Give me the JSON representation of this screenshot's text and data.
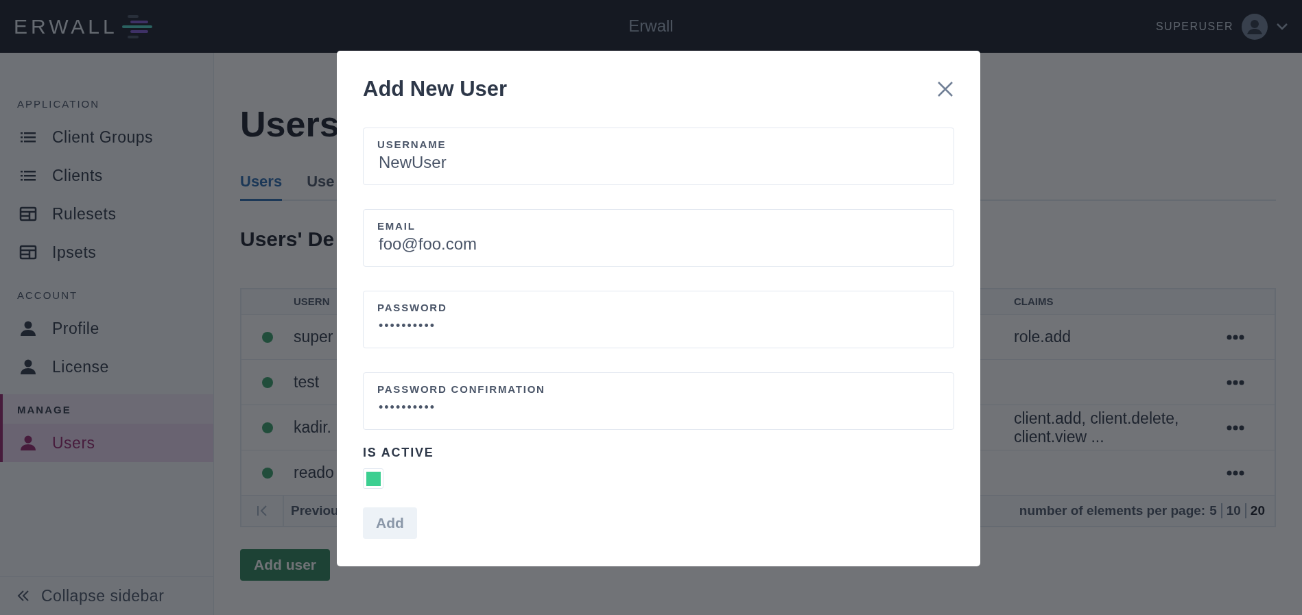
{
  "header": {
    "logo": "ERWALL",
    "title": "Erwall",
    "user": "SUPERUSER"
  },
  "sidebar": {
    "sections": [
      {
        "title": "APPLICATION",
        "items": [
          {
            "label": "Client Groups",
            "selected": false
          },
          {
            "label": "Clients",
            "selected": false
          },
          {
            "label": "Rulesets",
            "selected": false
          },
          {
            "label": "Ipsets",
            "selected": false
          }
        ]
      },
      {
        "title": "ACCOUNT",
        "items": [
          {
            "label": "Profile",
            "selected": false
          },
          {
            "label": "License",
            "selected": false
          }
        ]
      },
      {
        "title": "MANAGE",
        "items": [
          {
            "label": "Users",
            "selected": true
          }
        ]
      }
    ],
    "collapse": "Collapse sidebar"
  },
  "page": {
    "title": "Users",
    "tabs": [
      {
        "label": "Users",
        "selected": true
      },
      {
        "label": "Use",
        "selected": false
      }
    ],
    "section_title": "Users' De"
  },
  "table": {
    "columns": [
      "USERN",
      "CLAIMS"
    ],
    "rows": [
      {
        "active": true,
        "username": "super",
        "claims": "role.add"
      },
      {
        "active": true,
        "username": "test",
        "claims": ""
      },
      {
        "active": true,
        "username": "kadir.",
        "claims": "client.add, client.delete, client.view ..."
      },
      {
        "active": true,
        "username": "reado",
        "claims": ""
      }
    ],
    "pagination": {
      "previous": "Previou",
      "per_page_label": "number of elements per page:",
      "page_sizes": [
        {
          "label": "5",
          "selected": false
        },
        {
          "label": "10",
          "selected": false
        },
        {
          "label": "20",
          "selected": true
        }
      ]
    }
  },
  "add_user_button": "Add user",
  "modal": {
    "title": "Add New User",
    "fields": [
      {
        "label": "USERNAME",
        "value": "NewUser",
        "kind": "text"
      },
      {
        "label": "EMAIL",
        "value": "foo@foo.com",
        "kind": "text"
      },
      {
        "label": "PASSWORD",
        "value": "••••••••••",
        "kind": "password"
      },
      {
        "label": "PASSWORD CONFIRMATION",
        "value": "••••••••••",
        "kind": "password"
      }
    ],
    "is_active": {
      "label": "IS ACTIVE",
      "checked": true
    },
    "submit": {
      "label": "Add",
      "disabled": true
    }
  }
}
